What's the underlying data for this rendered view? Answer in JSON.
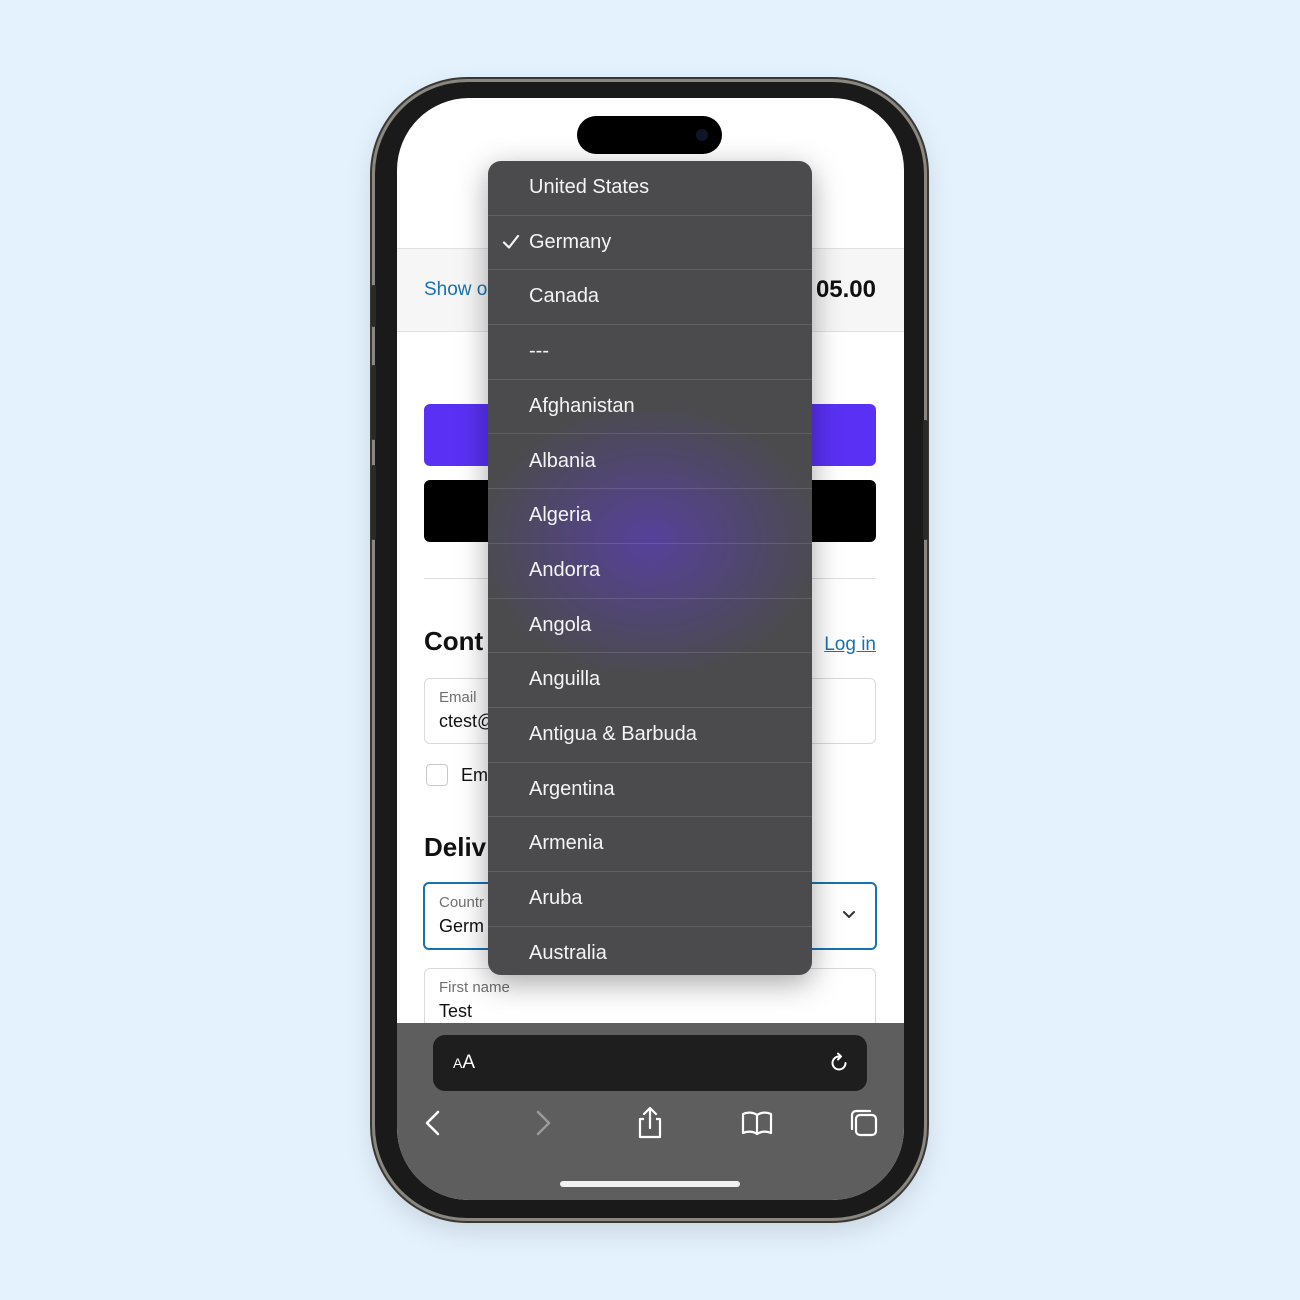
{
  "summary": {
    "show_order_label": "Show o",
    "total": "05.00"
  },
  "contact": {
    "heading": "Cont",
    "login_link": "Log in",
    "email_label": "Email",
    "email_value": "ctest@",
    "newsletter_label": "Em"
  },
  "delivery": {
    "heading": "Deliv",
    "country_label": "Countr",
    "country_value": "Germ",
    "first_name_label": "First name",
    "first_name_value": "Test"
  },
  "picker": {
    "selected": "Germany",
    "items": [
      {
        "label": "United States"
      },
      {
        "label": "Germany",
        "checked": true
      },
      {
        "label": "Canada"
      },
      {
        "label": "---"
      },
      {
        "label": "Afghanistan"
      },
      {
        "label": "Albania"
      },
      {
        "label": "Algeria"
      },
      {
        "label": "Andorra"
      },
      {
        "label": "Angola"
      },
      {
        "label": "Anguilla"
      },
      {
        "label": "Antigua & Barbuda"
      },
      {
        "label": "Argentina"
      },
      {
        "label": "Armenia"
      },
      {
        "label": "Aruba"
      },
      {
        "label": "Australia"
      }
    ]
  },
  "browser": {
    "aa_small": "A",
    "aa_large": "A",
    "icons": [
      "reload-icon",
      "back-icon",
      "forward-icon",
      "share-icon",
      "bookmarks-icon",
      "tabs-icon"
    ]
  },
  "colors": {
    "background": "#e4f2fd",
    "link": "#1773b0",
    "pay_button": "#5a31f4",
    "picker_bg": "#4b4b4d"
  }
}
